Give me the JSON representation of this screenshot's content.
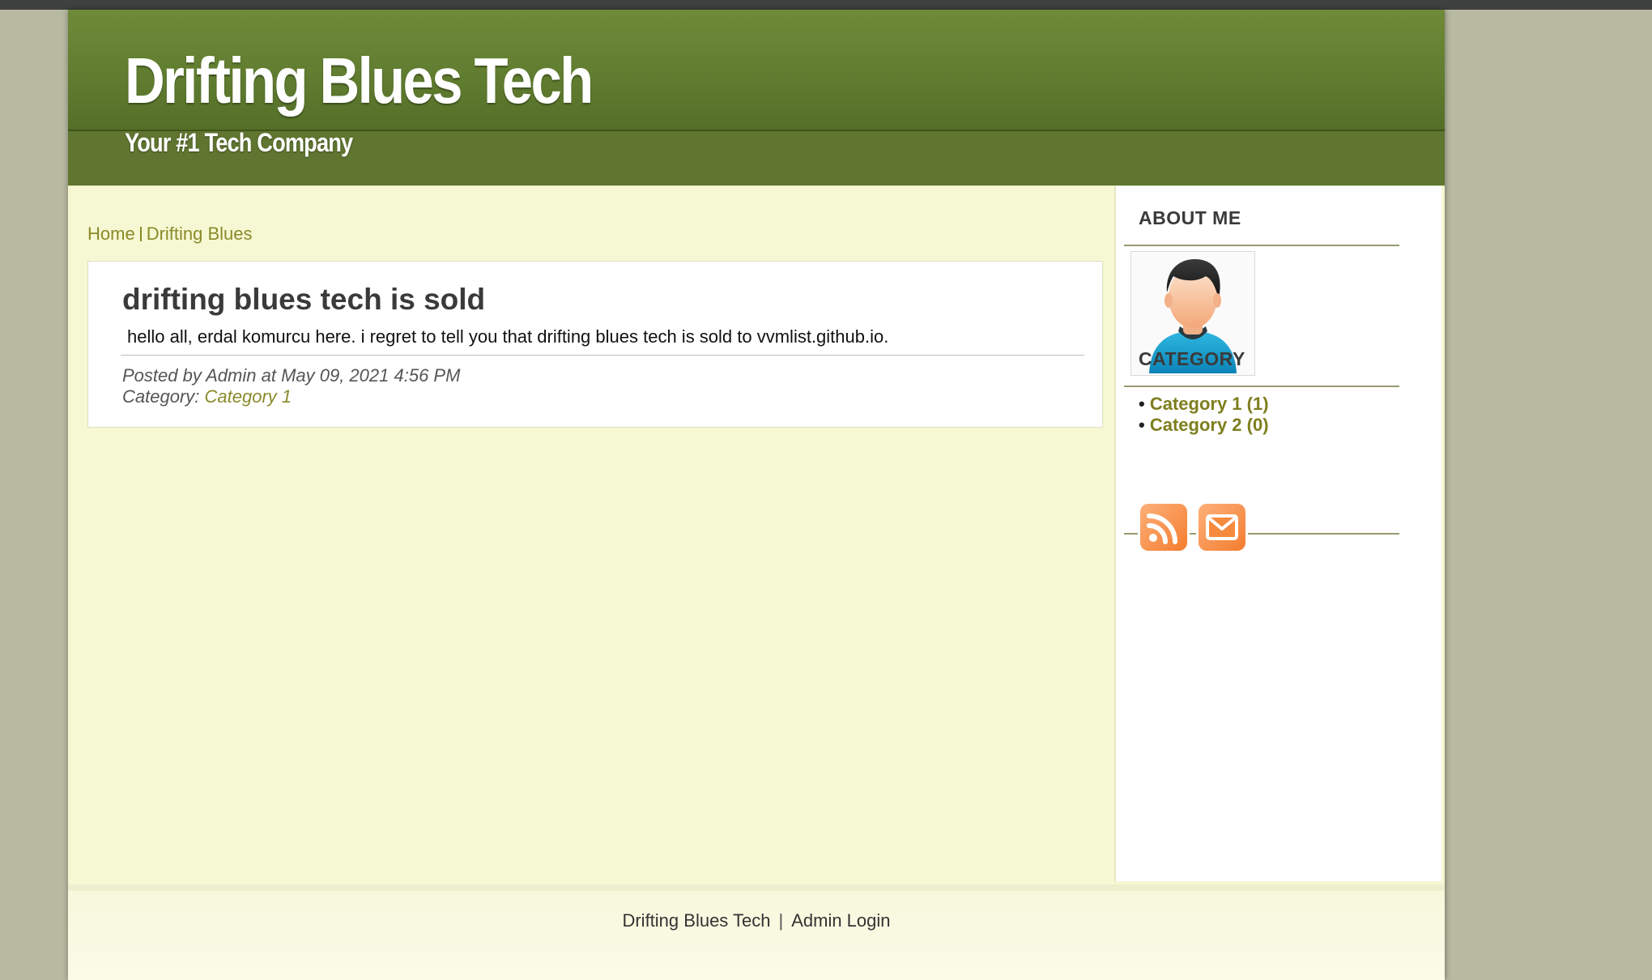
{
  "header": {
    "title": "Drifting Blues Tech",
    "tagline": "Your #1 Tech Company"
  },
  "breadcrumb": {
    "home": "Home",
    "current": "Drifting Blues"
  },
  "post": {
    "title": "drifting blues tech is sold",
    "body": "hello all, erdal komurcu here. i regret to tell you that drifting blues tech is sold to vvmlist.github.io.",
    "posted": "Posted by Admin at May 09, 2021 4:56 PM",
    "category_label": "Category: ",
    "category_link": "Category 1"
  },
  "sidebar": {
    "about_title": "ABOUT ME",
    "category_title": "CATEGORY",
    "categories": [
      {
        "label": "Category 1 (1)"
      },
      {
        "label": "Category 2 (0)"
      }
    ],
    "social": [
      {
        "icon": "rss-icon"
      },
      {
        "icon": "mail-icon"
      }
    ]
  },
  "footer": {
    "site_link": "Drifting Blues Tech",
    "separator": "|",
    "admin_link": "Admin Login"
  },
  "colors": {
    "header_green": "#5e7a2e",
    "content_bg": "#f6f8d3",
    "link_olive": "#8a8a2a",
    "social_orange": "#f47d2f"
  }
}
